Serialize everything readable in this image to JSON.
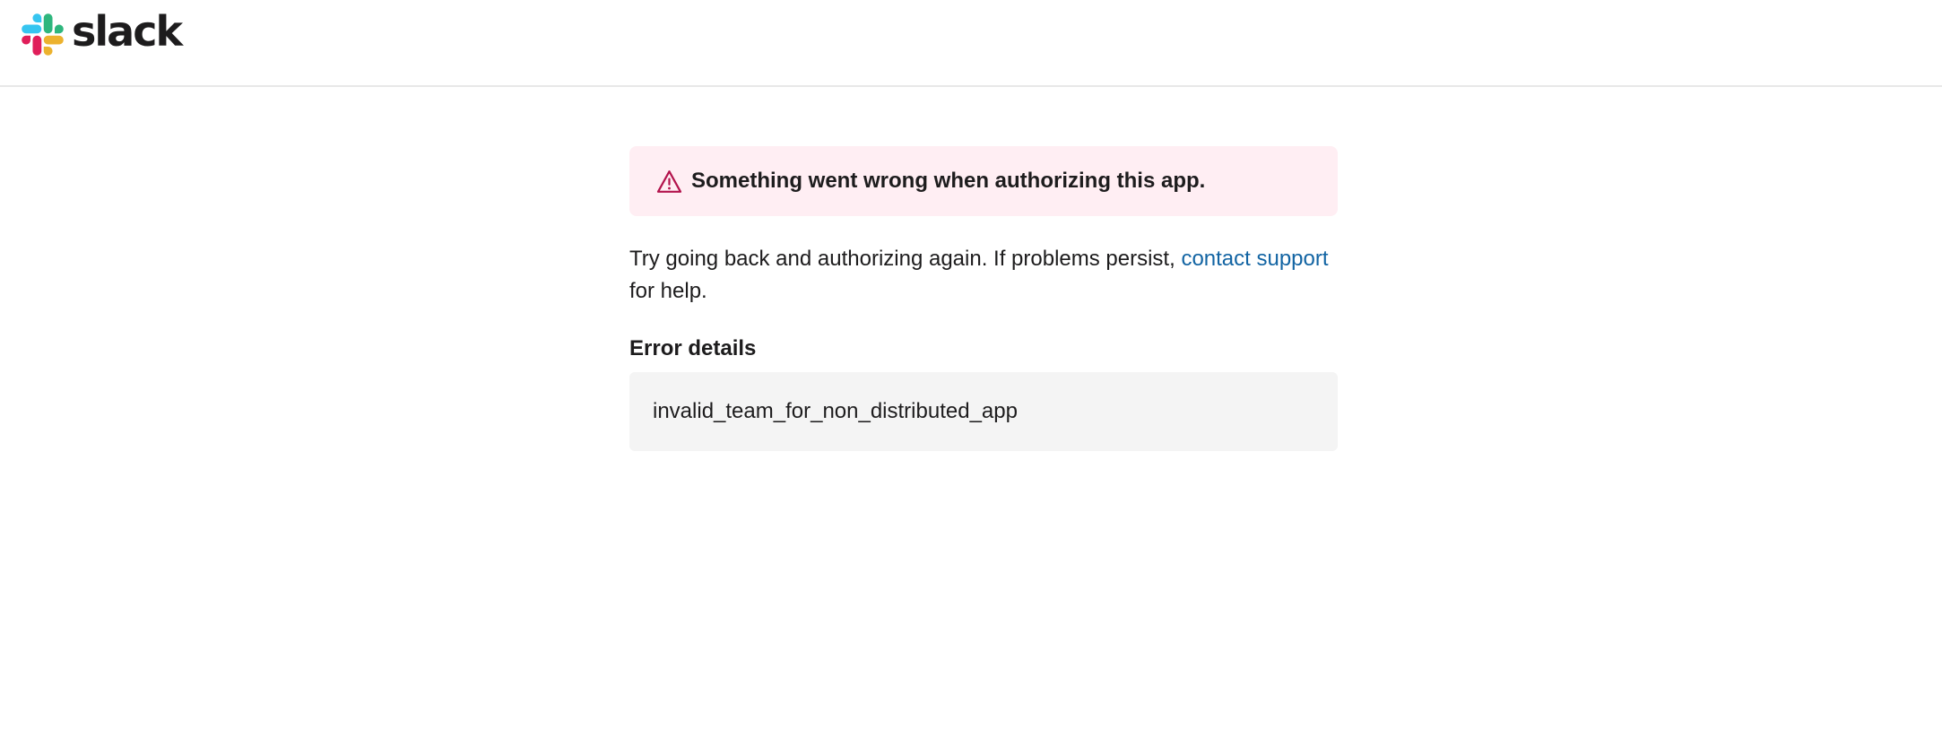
{
  "header": {
    "logo_text": "slack",
    "logo_icon": "slack-logo-icon"
  },
  "alert": {
    "icon": "warning-icon",
    "text": "Something went wrong when authorizing this app."
  },
  "message": {
    "before_link": "Try going back and authorizing again. If problems persist, ",
    "link_text": "contact support",
    "after_link": " for help."
  },
  "error_details": {
    "heading": "Error details",
    "code": "invalid_team_for_non_distributed_app"
  },
  "colors": {
    "alert_background": "#ffeef3",
    "alert_icon": "#b3134c",
    "link": "#1264a3",
    "details_background": "#f4f4f4"
  }
}
